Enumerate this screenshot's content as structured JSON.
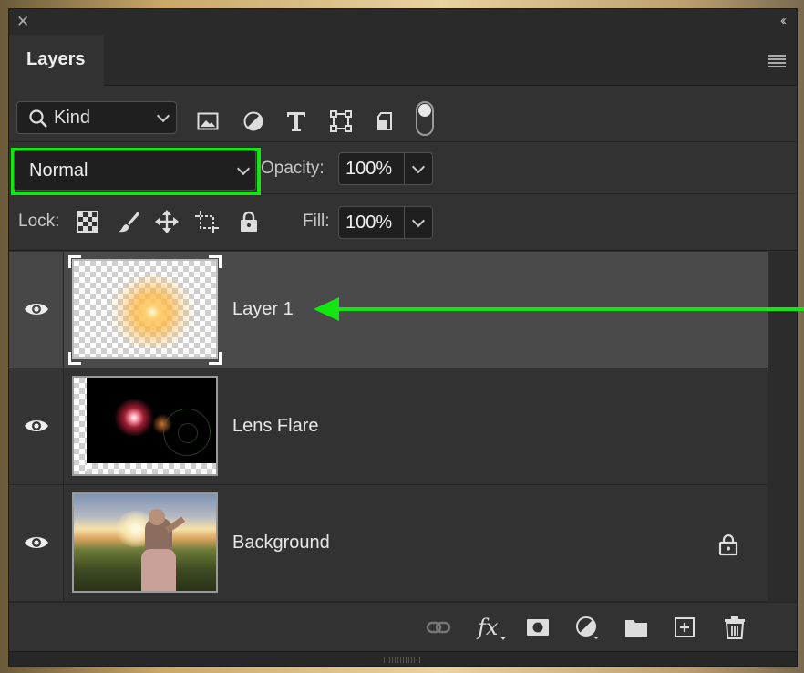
{
  "panel": {
    "close_glyph": "✕",
    "collapse_glyph": "‹‹",
    "tab_label": "Layers"
  },
  "filter": {
    "kind_label": "Kind",
    "icons": [
      "image-filter-icon",
      "adjustment-filter-icon",
      "type-filter-icon",
      "shape-filter-icon",
      "smart-object-filter-icon",
      "filter-toggle"
    ]
  },
  "blend": {
    "mode": "Normal",
    "opacity_label": "Opacity:",
    "opacity_value": "100%"
  },
  "lock": {
    "label": "Lock:",
    "icons": [
      "lock-transparency-icon",
      "lock-paint-icon",
      "lock-position-icon",
      "lock-artboard-icon",
      "lock-all-icon"
    ],
    "fill_label": "Fill:",
    "fill_value": "100%"
  },
  "layers": [
    {
      "name": "Layer 1",
      "visible": true,
      "selected": true,
      "locked": false
    },
    {
      "name": "Lens Flare",
      "visible": true,
      "selected": false,
      "locked": false
    },
    {
      "name": "Background",
      "visible": true,
      "selected": false,
      "locked": true
    }
  ],
  "footer": {
    "fx_label": "fx",
    "icons": [
      "link-layers-icon",
      "fx-icon",
      "mask-icon",
      "adjustment-layer-icon",
      "group-folder-icon",
      "new-layer-icon",
      "trash-icon"
    ]
  },
  "annotation": {
    "highlight_color": "#13e613"
  }
}
